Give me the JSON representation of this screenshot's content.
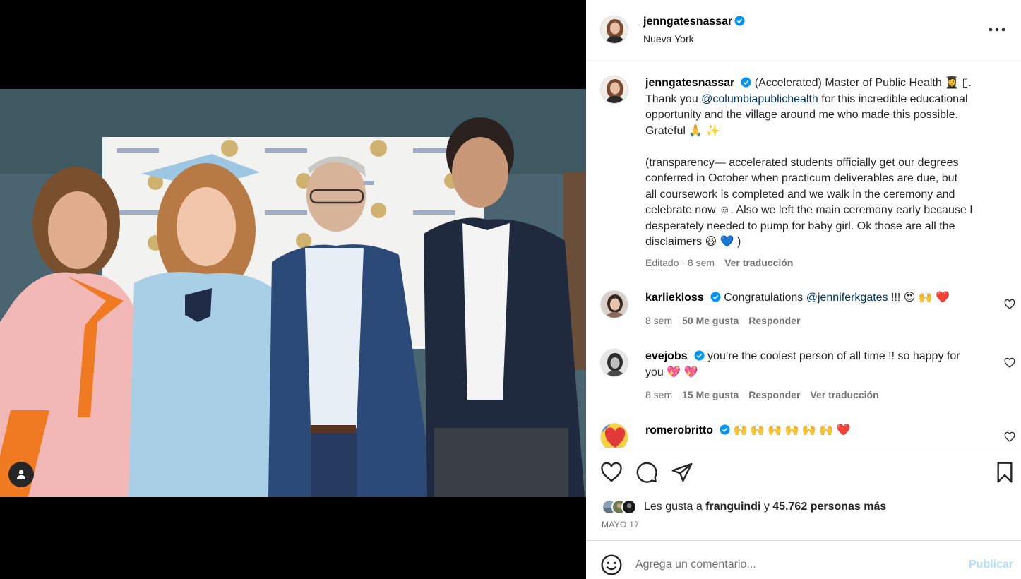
{
  "post": {
    "author": "jenngatesnassar",
    "location": "Nueva York",
    "caption": {
      "line1_pre": "(Accelerated) Master of Public Health 👩‍🎓",
      "line1_glyph": "▯.",
      "line2_pre": "Thank you ",
      "mention": "@columbiapublichealth",
      "line2_post": " for this incredible educational",
      "line3": "opportunity and the village around me who made this possible.",
      "line4": "Grateful 🙏 ✨",
      "para2_l1": "(transparency— accelerated students officially get our degrees",
      "para2_l2": "conferred in October when practicum deliverables are due, but",
      "para2_l3": "all coursework is completed and we walk in the ceremony and",
      "para2_l4": "celebrate now ☺. Also we left the main ceremony early because I",
      "para2_l5": "desperately needed to pump for baby girl. Ok those are all the",
      "para2_l6": "disclaimers 😆 💙 )"
    },
    "caption_meta": {
      "edited": "Editado · 8 sem",
      "translate": "Ver traducción"
    }
  },
  "comments": [
    {
      "user": "karliekloss",
      "text_pre": "Congratulations ",
      "mention": "@jenniferkgates",
      "text_post": " !!! 😍 🙌 ❤️",
      "age": "8 sem",
      "likes": "50 Me gusta",
      "reply": "Responder"
    },
    {
      "user": "evejobs",
      "text_l1": "you’re the coolest person of all time !! so happy for",
      "text_l2": "you 💖 💖",
      "age": "8 sem",
      "likes": "15 Me gusta",
      "reply": "Responder",
      "translate": "Ver traducción"
    },
    {
      "user": "romerobritto",
      "text": "🙌 🙌 🙌 🙌 🙌 🙌 ❤️"
    }
  ],
  "likes": {
    "prefix": "Les gusta a ",
    "first_user": "franguindi",
    "middle": " y ",
    "others": "45.762 personas más"
  },
  "date": "MAYO 17",
  "comment_box": {
    "placeholder": "Agrega un comentario...",
    "publish_label": "Publicar"
  },
  "colors": {
    "verified": "#0095f6",
    "mention": "#00376b",
    "publish_disabled": "#b2dffc",
    "divider": "#dbdbdb"
  }
}
